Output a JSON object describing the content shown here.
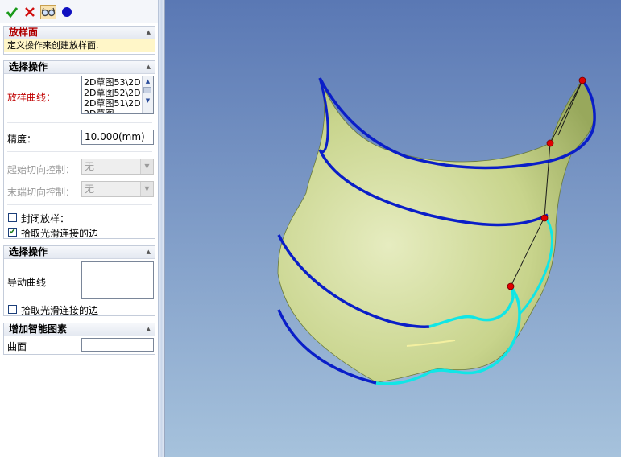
{
  "toolbar": {
    "ok_icon": "check-icon",
    "cancel_icon": "close-icon",
    "preview_icon": "glasses-icon",
    "apply_icon": "circle-icon"
  },
  "header": {
    "title": "放样面",
    "description": "定义操作来创建放样面."
  },
  "select_op": {
    "title": "选择操作",
    "curves_label": "放样曲线：",
    "curves": [
      "2D草图53\\2D",
      "2D草图52\\2D",
      "2D草图51\\2D"
    ],
    "precision_label": "精度：",
    "precision_value": "10.000(mm)",
    "start_tangent_label": "起始切向控制：",
    "start_tangent_value": "无",
    "end_tangent_label": "末端切向控制：",
    "end_tangent_value": "无",
    "closed_label": "封闭放样：",
    "closed_checked": false,
    "smooth_label": "拾取光滑连接的边",
    "smooth_checked": true
  },
  "select_op2": {
    "title": "选择操作",
    "guide_label": "导动曲线",
    "smooth_label": "拾取光滑连接的边",
    "smooth_checked": false
  },
  "smart": {
    "title": "增加智能图素",
    "surface_label": "曲面"
  },
  "colors": {
    "viewport_top": "#5a78b4",
    "viewport_bottom": "#a6c2dc",
    "surface": "#c8d48c",
    "curve_blue": "#0a1ec8",
    "curve_cyan": "#10e6e6",
    "point_red": "#e00000"
  }
}
